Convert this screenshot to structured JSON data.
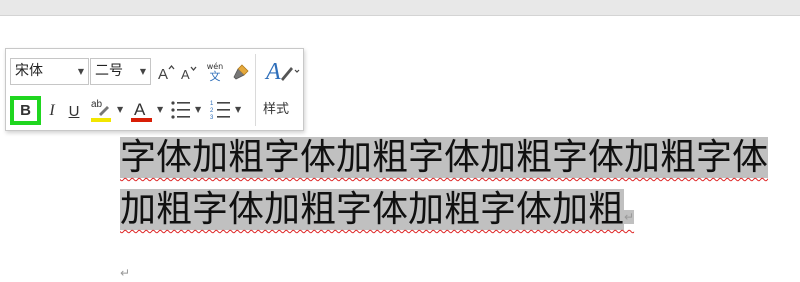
{
  "toolbar": {
    "font_name": "宋体",
    "font_size": "二号",
    "grow_font_icon": "A^",
    "shrink_font_icon": "A˅",
    "pinyin_label_top": "wén",
    "pinyin_label_bottom": "文",
    "bold_label": "B",
    "italic_label": "I",
    "underline_label": "U",
    "highlight_label": "ab",
    "font_color_label": "A",
    "style_label": "样式",
    "colors": {
      "highlight": "#f2e600",
      "font_color": "#d81e06",
      "style_accent": "#2f6fba",
      "bold_focus": "#1fd61f"
    }
  },
  "document": {
    "line1": "字体加粗字体加粗字体加粗字体加粗字体",
    "line2": "加粗字体加粗字体加粗字体加粗",
    "paragraph_mark": "↵"
  }
}
